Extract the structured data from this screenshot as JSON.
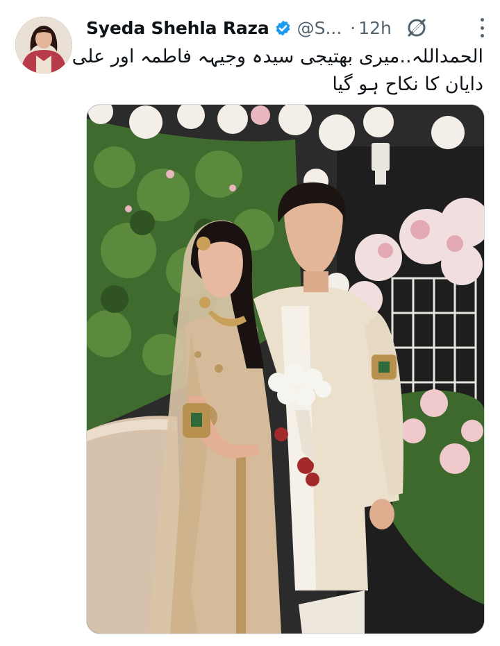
{
  "tweet": {
    "author_name": "Syeda Shehla Raza",
    "handle": "@S...",
    "separator": "·",
    "time": "12h",
    "text_lines": [
      "الحمداللہ..میری بھتیجی سیدہ وجیہہ فاطمہ اور علی",
      "دایان کا نکاح ہو گیا"
    ]
  },
  "icons": {
    "verified": "verified-badge-icon",
    "grok": "grok-icon",
    "more": "more-options-icon",
    "avatar": "profile-avatar"
  },
  "colors": {
    "verified_blue": "#1d9bf0",
    "secondary_text": "#536471",
    "primary_text": "#0f1419"
  }
}
